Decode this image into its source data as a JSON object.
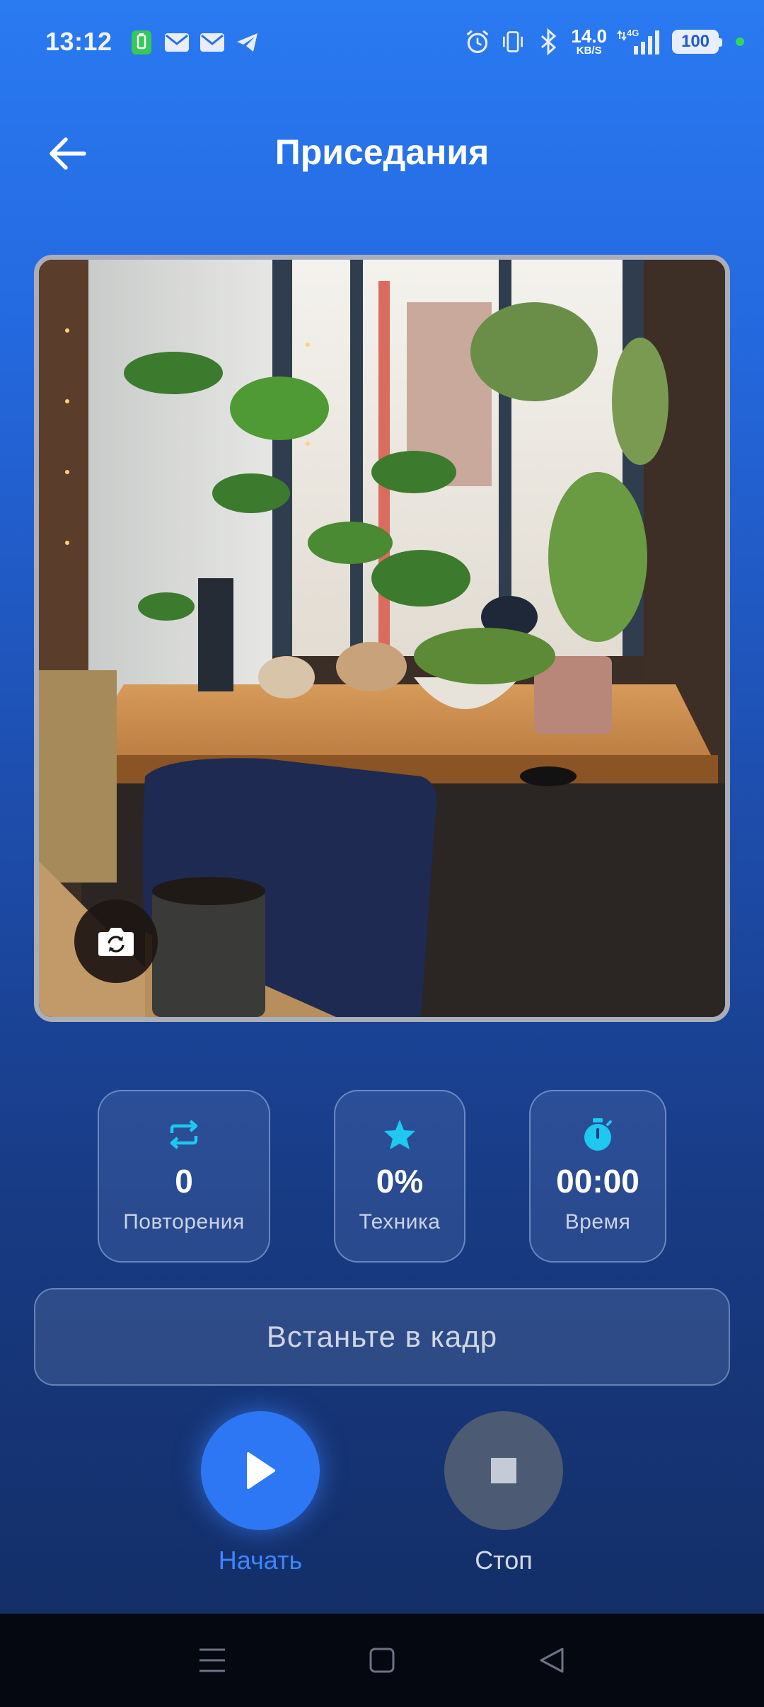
{
  "status_bar": {
    "time": "13:12",
    "net_speed_value": "14.0",
    "net_speed_unit": "KB/S",
    "network_type": "4G",
    "battery": "100"
  },
  "header": {
    "title": "Приседания"
  },
  "stats": {
    "reps": {
      "value": "0",
      "label": "Повторения",
      "icon": "repeat-icon"
    },
    "technique": {
      "value": "0%",
      "label": "Техника",
      "icon": "star-icon"
    },
    "time": {
      "value": "00:00",
      "label": "Время",
      "icon": "stopwatch-icon"
    }
  },
  "prompt": "Встаньте в кадр",
  "controls": {
    "start_label": "Начать",
    "stop_label": "Стоп"
  },
  "colors": {
    "accent": "#2d77f4",
    "stat_icon": "#1ec8f0"
  }
}
